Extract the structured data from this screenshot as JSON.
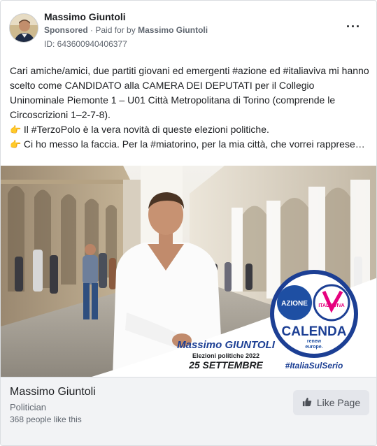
{
  "header": {
    "page_name": "Massimo Giuntoli",
    "sponsored": "Sponsored",
    "paid_prefix": "Paid for by",
    "paid_by": "Massimo Giuntoli",
    "ad_id": "ID: 643600940406377",
    "more_icon": "more-horizontal-icon"
  },
  "body": {
    "lines": [
      "Cari amiche/amici, due partiti giovani ed emergenti #azione ed #italiaviva mi hanno scelto come CANDIDATO alla CAMERA DEI DEPUTATI per il Collegio Uninominale Piemonte 1 – U01 Città Metropolitana di Torino (comprende le Circoscrizioni 1–2-7-8).",
      "Il #TerzoPolo è la vera novità di queste elezioni politiche.",
      "Ci ho messo la faccia. Per la #miatorino, per la mia città, che vorrei rappresentare in Parlamento, portando le istanze di tutti i cittadini, senza lasciare..."
    ],
    "bullet_emoji": "👉"
  },
  "media": {
    "candidate_first": "Massimo",
    "candidate_last": "GIUNTOLI",
    "election": "Elezioni politiche 2022",
    "date": "25 SETTEMBRE",
    "logo_left": "AZIONE",
    "logo_right": "ITALIAVIVA",
    "logo_main": "CALENDA",
    "logo_sub1": "renew",
    "logo_sub2": "europe.",
    "hashtag": "#ItaliaSulSerio"
  },
  "footer": {
    "title": "Massimo Giuntoli",
    "category": "Politician",
    "likes": "368 people like this",
    "like_button": "Like Page",
    "like_icon": "thumbs-up-icon"
  },
  "colors": {
    "azione_blue": "#1e4fa3",
    "calenda_blue": "#1c3f94",
    "italiaviva_pink": "#e6007e",
    "text_dark": "#1c1e21",
    "text_muted": "#606770"
  }
}
